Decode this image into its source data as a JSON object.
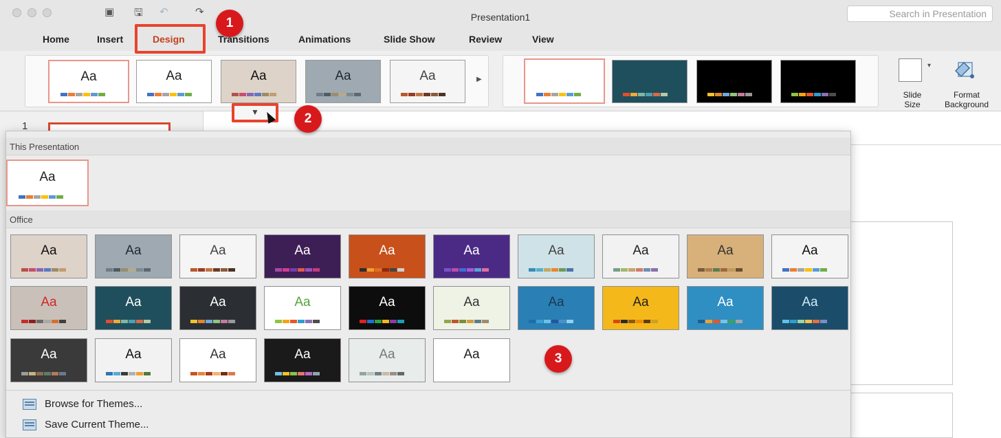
{
  "window": {
    "title": "Presentation1",
    "search_placeholder": "Search in Presentation",
    "traffic_lights": [
      "close",
      "minimize",
      "zoom"
    ],
    "quick_access_icons": [
      "slide-panel-icon",
      "save-icon",
      "undo-icon",
      "redo-icon"
    ]
  },
  "tabs": [
    {
      "label": "Home",
      "active": false
    },
    {
      "label": "Insert",
      "active": false
    },
    {
      "label": "Design",
      "active": true
    },
    {
      "label": "Transitions",
      "active": false
    },
    {
      "label": "Animations",
      "active": false
    },
    {
      "label": "Slide Show",
      "active": false
    },
    {
      "label": "Review",
      "active": false
    },
    {
      "label": "View",
      "active": false
    }
  ],
  "ribbon": {
    "theme_gallery_thumb_text": "Aa",
    "slide_size_line1": "Slide",
    "slide_size_line2": "Size",
    "format_background_line1": "Format",
    "format_background_line2": "Background"
  },
  "slide_pane": {
    "slide_number": "1"
  },
  "dropdown": {
    "this_presentation_label": "This Presentation",
    "office_label": "Office",
    "thumb_text": "Aa",
    "browse_themes": "Browse for Themes...",
    "save_current_theme": "Save Current Theme..."
  },
  "callouts": [
    "1",
    "2",
    "3"
  ],
  "colors": {
    "accent_red": "#e8432e",
    "badge_red": "#d8191c",
    "active_tab": "#c43e1c",
    "selection_pink": "#e8968a"
  },
  "themes": [
    {
      "bg": "#ffffff",
      "fg": "#222222",
      "swatch": [
        "#4472c4",
        "#ed7d31",
        "#a5a5a5",
        "#ffc000",
        "#5b9bd5",
        "#70ad47"
      ]
    },
    {
      "bg": "#ddd3c9",
      "fg": "#111111",
      "swatch": [
        "#b4534c",
        "#c94e6e",
        "#8867b3",
        "#5b7ac2",
        "#9c8a6a",
        "#c29d6f"
      ]
    },
    {
      "bg": "#9ea9b1",
      "fg": "#1e2b33",
      "swatch": [
        "#6f7e86",
        "#4f5b62",
        "#9a8d6e",
        "#b8a98a",
        "#7b8b92",
        "#5d6970"
      ]
    },
    {
      "bg": "#f5f5f5",
      "fg": "#444444",
      "swatch": [
        "#b85a2b",
        "#9b3a26",
        "#c07544",
        "#6a3a26",
        "#8b5a3c",
        "#4d3225"
      ]
    },
    {
      "bg": "#3d1f55",
      "fg": "#ffffff",
      "swatch": [
        "#a34aa8",
        "#d43b8f",
        "#6e3fb4",
        "#e05a47",
        "#9a51c2",
        "#c33c7a"
      ]
    },
    {
      "bg": "#c8501a",
      "fg": "#ffffff",
      "swatch": [
        "#2e2e2e",
        "#f0a030",
        "#e06e20",
        "#8a2a10",
        "#444444",
        "#d0d0d0"
      ]
    },
    {
      "bg": "#4b2a86",
      "fg": "#ffffff",
      "swatch": [
        "#7a52c7",
        "#c04aa6",
        "#3c6fd1",
        "#a55ad0",
        "#5aa3d6",
        "#e36c9b"
      ]
    },
    {
      "bg": "#cfe2e8",
      "fg": "#444444",
      "swatch": [
        "#3a8db4",
        "#57b0c9",
        "#c4a95e",
        "#e8872c",
        "#6d9a59",
        "#4e73a6"
      ]
    },
    {
      "bg": "#f2f2f2",
      "fg": "#222222",
      "swatch": [
        "#7a9d8a",
        "#a3b86c",
        "#c7a36e",
        "#d17b6c",
        "#6e8fb2",
        "#8a6fa8"
      ]
    },
    {
      "bg": "#d7b07a",
      "fg": "#333333",
      "swatch": [
        "#7a5b3a",
        "#a7804c",
        "#5a7d52",
        "#9a6b3e",
        "#c19a60",
        "#6a4e32"
      ]
    },
    {
      "bg": "#f4f4f4",
      "fg": "#111111",
      "swatch": [
        "#4472c4",
        "#ed7d31",
        "#a5a5a5",
        "#ffc000",
        "#5b9bd5",
        "#70ad47"
      ]
    },
    {
      "bg": "#c9c1b9",
      "fg": "#d12626",
      "swatch": [
        "#c82b2b",
        "#8e1f1f",
        "#6b6b6b",
        "#a9a9a9",
        "#d96e2c",
        "#3f3f3f"
      ]
    },
    {
      "bg": "#1f4f5c",
      "fg": "#ffffff",
      "swatch": [
        "#e24e2b",
        "#f2a93a",
        "#7fb7a5",
        "#4f9fb0",
        "#d96a45",
        "#b6c9a4"
      ]
    },
    {
      "bg": "#2b2f33",
      "fg": "#ffffff",
      "swatch": [
        "#f2c12e",
        "#e0872f",
        "#6fa8dc",
        "#93c47d",
        "#c27ba0",
        "#999999"
      ]
    },
    {
      "bg": "#ffffff",
      "fg": "#57a33c",
      "swatch": [
        "#8dc63f",
        "#f7a11a",
        "#e8562a",
        "#2b9fd0",
        "#8b6fb3",
        "#4d4d4d"
      ]
    },
    {
      "bg": "#0d0d0d",
      "fg": "#ffffff",
      "swatch": [
        "#e0201b",
        "#1f6fd1",
        "#2ca340",
        "#f2b71f",
        "#8b3ea8",
        "#18a0b5"
      ]
    },
    {
      "bg": "#eef3e6",
      "fg": "#333333",
      "swatch": [
        "#93a74e",
        "#c3532e",
        "#7a8f3a",
        "#d69b3c",
        "#5e7d8a",
        "#a58b6a"
      ]
    },
    {
      "bg": "#2a7fb5",
      "fg": "#1a3a4d",
      "swatch": [
        "#1d70a6",
        "#39a0d4",
        "#6cc2e6",
        "#2356a3",
        "#4f8fc7",
        "#91d1ee"
      ]
    },
    {
      "bg": "#f5b81a",
      "fg": "#222222",
      "swatch": [
        "#d9480f",
        "#2b2b2b",
        "#8a5a14",
        "#f08c00",
        "#5a3e0f",
        "#c9a227"
      ]
    },
    {
      "bg": "#2f8fc3",
      "fg": "#ffffff",
      "swatch": [
        "#1b5f8f",
        "#f0a22e",
        "#e4572e",
        "#7cc2e0",
        "#3aa15f",
        "#a6a6a6"
      ]
    },
    {
      "bg": "#1b4d6b",
      "fg": "#cfe9f5",
      "swatch": [
        "#5fc2e8",
        "#2e9fcf",
        "#9fd5a3",
        "#f2c14e",
        "#e36f47",
        "#7b8cc4"
      ]
    },
    {
      "bg": "#3a3a3a",
      "fg": "#ffffff",
      "swatch": [
        "#9c9c9c",
        "#c7b37e",
        "#8c6f4d",
        "#5e7c6a",
        "#b57b5c",
        "#6b7a8f"
      ]
    },
    {
      "bg": "#f2f2f2",
      "fg": "#111111",
      "swatch": [
        "#2e75b6",
        "#59a8d8",
        "#3a3a3a",
        "#b0b0b0",
        "#f0a030",
        "#4f7a3a"
      ]
    },
    {
      "bg": "#ffffff",
      "fg": "#333333",
      "swatch": [
        "#c9541d",
        "#e08a3c",
        "#a83a1a",
        "#f2b36b",
        "#7a2a10",
        "#d97a4a"
      ]
    },
    {
      "bg": "#1a1a1a",
      "fg": "#ffffff",
      "swatch": [
        "#6ec1e4",
        "#f2c12e",
        "#8bc34a",
        "#e57373",
        "#ba68c8",
        "#90a4ae"
      ]
    },
    {
      "bg": "#e8ecea",
      "fg": "#777777",
      "swatch": [
        "#8fa6a0",
        "#b7c6c2",
        "#6f7f8a",
        "#c7b9a8",
        "#9a8f86",
        "#5d6b70"
      ]
    }
  ]
}
